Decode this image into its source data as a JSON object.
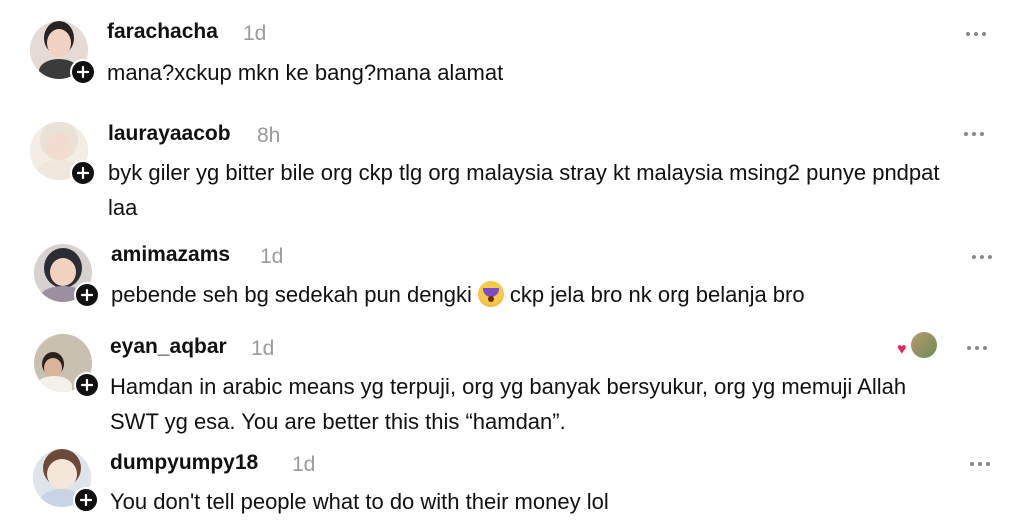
{
  "comments": [
    {
      "username": "farachacha",
      "time": "1d",
      "text": "mana?xckup mkn ke bang?mana alamat",
      "avatar_colors": {
        "bg": "#e6dbd4",
        "head": "#f0d3c2",
        "hair": "#2a2220",
        "body": "#3b3b3b"
      }
    },
    {
      "username": "laurayaacob",
      "time": "8h",
      "text": "byk giler yg bitter bile org ckp tlg org malaysia stray kt malaysia msing2 punye pndpat laa",
      "avatar_colors": {
        "bg": "#f3ede4",
        "head": "#f2dccf",
        "hair": "#e9e2d6",
        "body": "#efe7dc"
      }
    },
    {
      "username": "amimazams",
      "time": "1d",
      "text_before": "pebende seh bg sedekah pun dengki",
      "emoji": "crying-face-emoji",
      "text_after": "ckp jela bro nk org belanja bro",
      "avatar_colors": {
        "bg": "#d7d2cf",
        "head": "#f1d2bf",
        "hair": "#2c2c35",
        "body": "#9b8fa0"
      }
    },
    {
      "username": "eyan_aqbar",
      "time": "1d",
      "text": "Hamdan in arabic means yg terpuji, org yg banyak bersyukur, org yg memuji Allah SWT yg esa. You are better this this “hamdan”.",
      "liked_by_creator": true,
      "avatar_colors": {
        "bg": "#c9c0b0",
        "head": "#d8b49a",
        "hair": "#2a211b",
        "body": "#f4f1ea"
      }
    },
    {
      "username": "dumpyumpy18",
      "time": "1d",
      "text": "You don't tell people what to do with their money lol",
      "avatar_colors": {
        "bg": "#dfe3ea",
        "head": "#f5e6da",
        "hair": "#6b4a3a",
        "body": "#c9d3e6"
      }
    }
  ],
  "icons": {
    "follow": "plus-icon",
    "more": "more-options-icon",
    "liked": "heart-icon"
  }
}
